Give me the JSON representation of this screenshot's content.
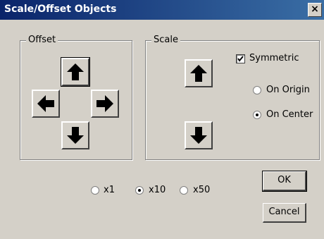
{
  "window": {
    "title": "Scale/Offset Objects",
    "close_label": "×"
  },
  "offset": {
    "legend": "Offset",
    "buttons": [
      {
        "icon": "arrow-up-icon"
      },
      {
        "icon": "arrow-left-icon"
      },
      {
        "icon": "arrow-right-icon"
      },
      {
        "icon": "arrow-down-icon"
      }
    ]
  },
  "scale": {
    "legend": "Scale",
    "symmetric": {
      "label": "Symmetric",
      "checked": true
    },
    "origin_options": [
      {
        "label": "On Origin",
        "selected": false
      },
      {
        "label": "On Center",
        "selected": true
      }
    ],
    "buttons": [
      {
        "icon": "arrow-up-icon"
      },
      {
        "icon": "arrow-down-icon"
      }
    ]
  },
  "multiplier": {
    "options": [
      {
        "label": "x1",
        "selected": false
      },
      {
        "label": "x10",
        "selected": true
      },
      {
        "label": "x50",
        "selected": false
      }
    ]
  },
  "actions": {
    "ok_label": "OK",
    "cancel_label": "Cancel"
  }
}
